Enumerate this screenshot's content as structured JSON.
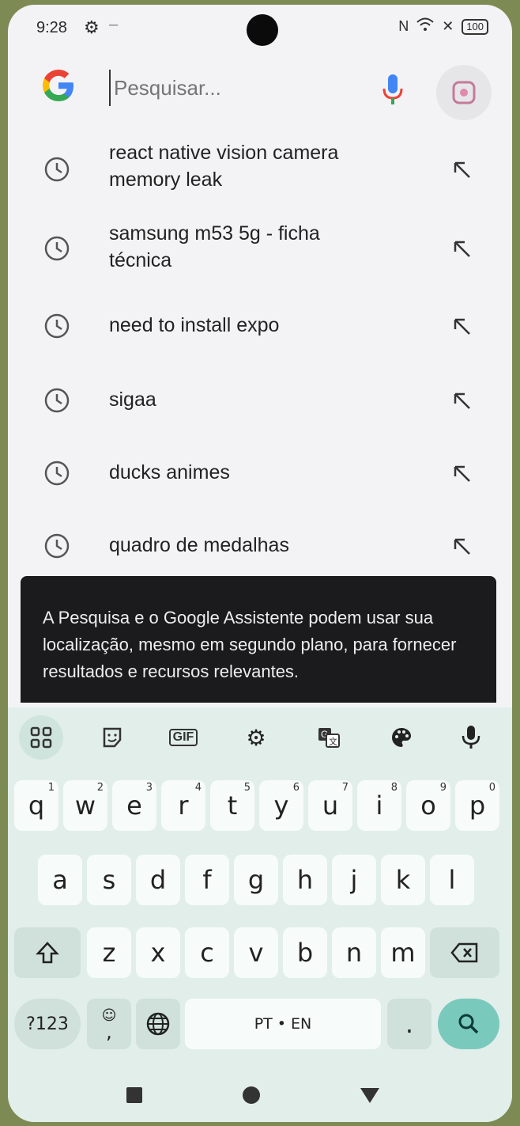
{
  "status": {
    "time": "9:28",
    "dash": "–",
    "battery": "100"
  },
  "search": {
    "placeholder": "Pesquisar..."
  },
  "suggestions": [
    {
      "line1": "react native vision camera",
      "line2": "memory leak"
    },
    {
      "line1": "samsung m53 5g - ficha",
      "line2": "técnica"
    },
    {
      "line1": "need to install expo",
      "line2": ""
    },
    {
      "line1": "sigaa",
      "line2": ""
    },
    {
      "line1": "ducks animes",
      "line2": ""
    },
    {
      "line1": "quadro de medalhas",
      "line2": ""
    }
  ],
  "notice": {
    "text": "A Pesquisa e o Google Assistente podem usar sua localização, mesmo em segundo plano, para fornecer resultados e recursos relevantes."
  },
  "keyboard": {
    "gif_label": "GIF",
    "row1": [
      {
        "k": "q",
        "n": "1"
      },
      {
        "k": "w",
        "n": "2"
      },
      {
        "k": "e",
        "n": "3"
      },
      {
        "k": "r",
        "n": "4"
      },
      {
        "k": "t",
        "n": "5"
      },
      {
        "k": "y",
        "n": "6"
      },
      {
        "k": "u",
        "n": "7"
      },
      {
        "k": "i",
        "n": "8"
      },
      {
        "k": "o",
        "n": "9"
      },
      {
        "k": "p",
        "n": "0"
      }
    ],
    "row2": [
      "a",
      "s",
      "d",
      "f",
      "g",
      "h",
      "j",
      "k",
      "l"
    ],
    "row3": [
      "z",
      "x",
      "c",
      "v",
      "b",
      "n",
      "m"
    ],
    "symbols_label": "?123",
    "emoji_comma": ",",
    "space_label": "PT • EN",
    "period": "."
  },
  "colors": {
    "google_blue": "#4285f4",
    "accent": "#79c9bd"
  }
}
